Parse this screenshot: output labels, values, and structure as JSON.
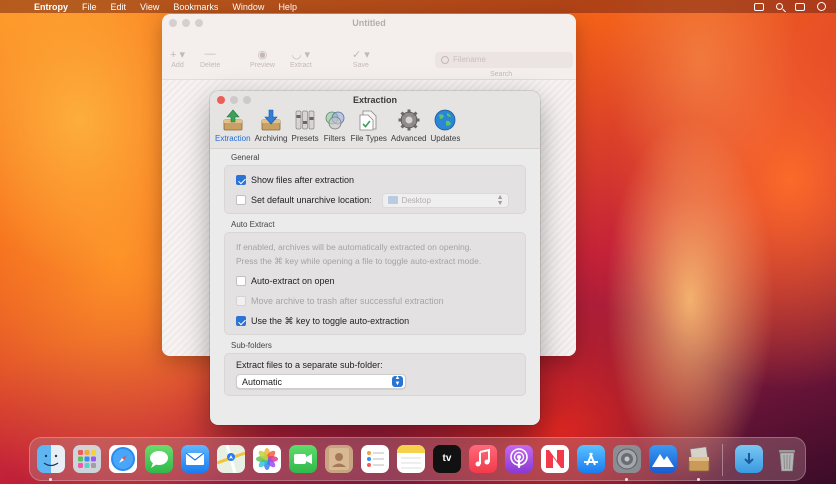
{
  "menubar": {
    "apple": "",
    "app_name": "Entropy",
    "items": [
      "File",
      "Edit",
      "View",
      "Bookmarks",
      "Window",
      "Help"
    ]
  },
  "background_window": {
    "title": "Untitled",
    "toolbar": {
      "add": "Add",
      "delete": "Delete",
      "preview": "Preview",
      "extract": "Extract",
      "save": "Save",
      "search_label": "Search",
      "search_placeholder": "Filename"
    }
  },
  "prefs_window": {
    "title": "Extraction",
    "tabs": [
      {
        "label": "Extraction",
        "icon": "extraction-icon",
        "active": true
      },
      {
        "label": "Archiving",
        "icon": "archiving-icon"
      },
      {
        "label": "Presets",
        "icon": "presets-icon"
      },
      {
        "label": "Filters",
        "icon": "filters-icon"
      },
      {
        "label": "File Types",
        "icon": "file-types-icon"
      },
      {
        "label": "Advanced",
        "icon": "gear-icon"
      },
      {
        "label": "Updates",
        "icon": "globe-icon"
      }
    ],
    "general": {
      "heading": "General",
      "show_files": "Show files after extraction",
      "set_default": "Set default unarchive location:",
      "location_value": "Desktop"
    },
    "auto_extract": {
      "heading": "Auto Extract",
      "description_line1": "If enabled, archives will be automatically extracted on opening.",
      "description_line2": "Press the ⌘ key while opening a file to toggle auto-extract mode.",
      "auto_extract_on_open": "Auto-extract on open",
      "move_to_trash": "Move archive to trash after successful extraction",
      "use_cmd_key": "Use the ⌘ key to toggle auto-extraction"
    },
    "subfolders": {
      "heading": "Sub-folders",
      "label": "Extract files to a separate sub-folder:",
      "value": "Automatic"
    }
  },
  "dock": {
    "apps": [
      "finder",
      "launchpad",
      "safari",
      "messages",
      "mail",
      "maps",
      "photos",
      "facetime",
      "contacts",
      "reminders",
      "notes",
      "tv",
      "music",
      "podcasts",
      "news",
      "app-store",
      "system-preferences",
      "altitude",
      "entropy"
    ],
    "tv_label": "tv",
    "trailing": [
      "downloads",
      "trash"
    ]
  }
}
